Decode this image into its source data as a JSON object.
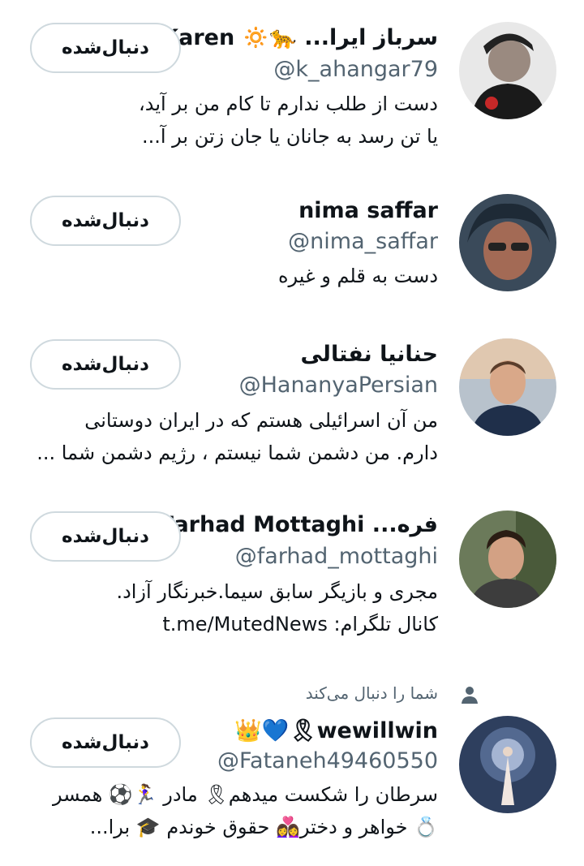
{
  "follow_label": "دنبال‌شده",
  "users": [
    {
      "name": "سرباز ایرا... 🐆🔅 Karen",
      "handle": "@k_ahangar79",
      "bio_lines": [
        "دست از طلب ندارم تا کام من بر آید،",
        "یا تن رسد به جانان یا جان زتن بر آ..."
      ]
    },
    {
      "name": "nima saffar",
      "handle": "@nima_saffar",
      "bio_lines": [
        "دست به قلم و غیره"
      ]
    },
    {
      "name": "حنانیا نفتالی",
      "handle": "@HananyaPersian",
      "bio_lines": [
        "من آن اسرائیلی هستم که در ایران دوستانی",
        "دارم. من دشمن شما نیستم ، رژیم دشمن شما ..."
      ]
    },
    {
      "name": "فره... Farhad Mottaghi",
      "handle": "@farhad_mottaghi",
      "bio_lines": [
        "مجری و بازیگر سابق سیما.خبرنگار آزاد.",
        "کانال تلگرام: t.me/MutedNews"
      ]
    },
    {
      "follows_you": "شما را دنبال می‌کند",
      "name": "wewillwin🎗💙👑",
      "handle": "@Fataneh49460550",
      "bio_lines": [
        "سرطان را شکست میدهم🎗 مادر 🏃‍♀️⚽ همسر",
        "💍 خواهر و دختر👩‍❤️‍👩 حقوق خوندم 🎓 برا..."
      ]
    }
  ]
}
